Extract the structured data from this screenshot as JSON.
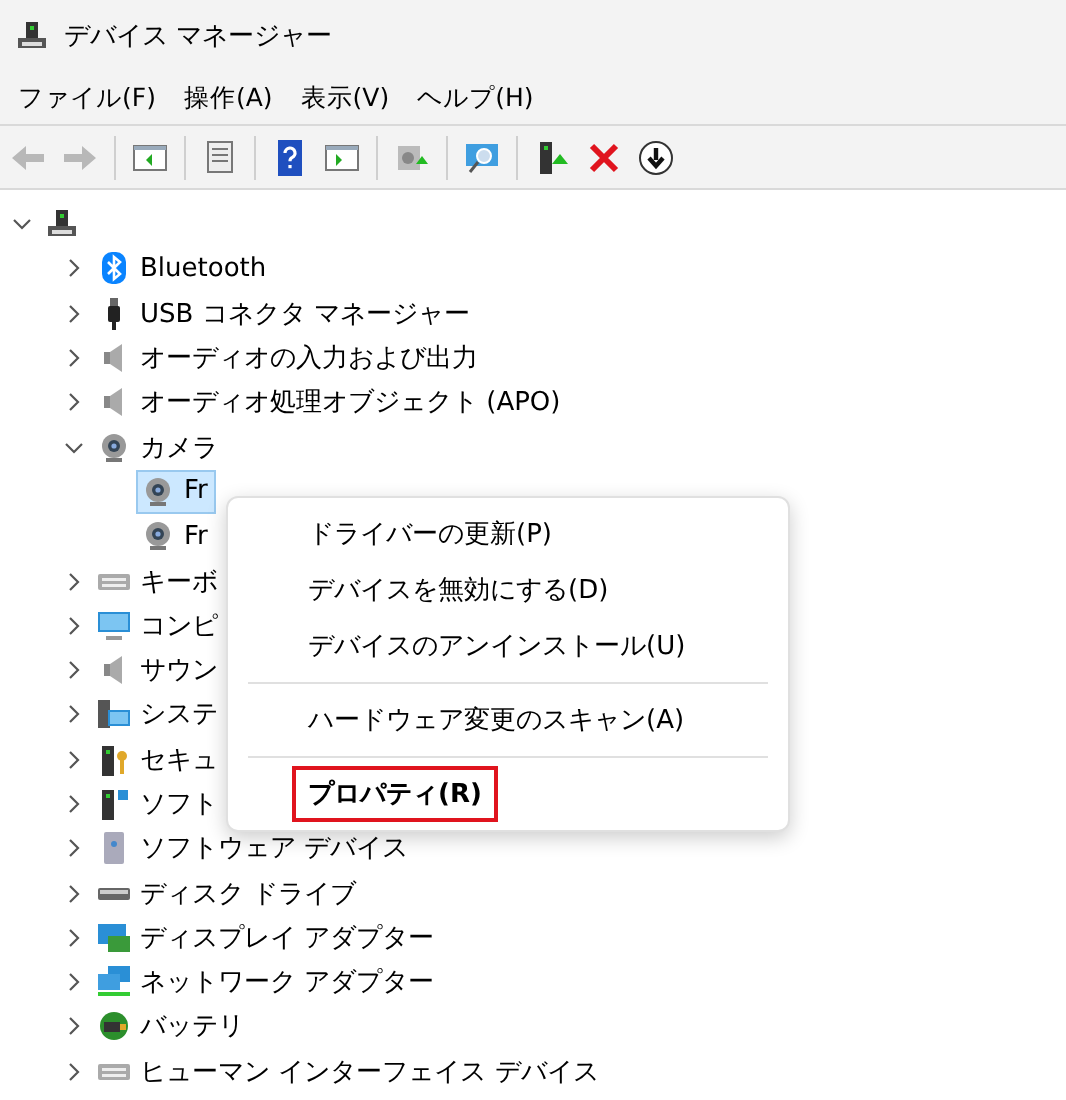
{
  "window": {
    "title": "デバイス マネージャー"
  },
  "menu": [
    "ファイル(F)",
    "操作(A)",
    "表示(V)",
    "ヘルプ(H)"
  ],
  "toolbar": [
    {
      "kind": "back",
      "disabled": true
    },
    {
      "kind": "forward",
      "disabled": true
    },
    {
      "kind": "separator"
    },
    {
      "kind": "tree"
    },
    {
      "kind": "separator"
    },
    {
      "kind": "properties"
    },
    {
      "kind": "separator"
    },
    {
      "kind": "help"
    },
    {
      "kind": "pane"
    },
    {
      "kind": "separator"
    },
    {
      "kind": "update"
    },
    {
      "kind": "separator"
    },
    {
      "kind": "scan"
    },
    {
      "kind": "separator"
    },
    {
      "kind": "enable"
    },
    {
      "kind": "uninstall"
    },
    {
      "kind": "disable"
    }
  ],
  "tree": {
    "kind": "computer",
    "expanded": true,
    "children": [
      {
        "label": "Bluetooth",
        "kind": "bluetooth",
        "expanded": false
      },
      {
        "label": "USB コネクタ マネージャー",
        "kind": "usb",
        "expanded": false
      },
      {
        "label": "オーディオの入力および出力",
        "kind": "speaker",
        "expanded": false
      },
      {
        "label": "オーディオ処理オブジェクト (APO)",
        "kind": "speaker",
        "expanded": false
      },
      {
        "label": "カメラ",
        "kind": "camera",
        "expanded": true,
        "children": [
          {
            "label": "Fr",
            "kind": "camera",
            "selected": true
          },
          {
            "label": "Fr",
            "kind": "camera",
            "selected": false
          }
        ]
      },
      {
        "label": "キーボ",
        "kind": "keyboard",
        "expanded": false
      },
      {
        "label": "コンピ",
        "kind": "monitor",
        "expanded": false
      },
      {
        "label": "サウン",
        "kind": "speaker",
        "expanded": false
      },
      {
        "label": "システ",
        "kind": "system",
        "expanded": false
      },
      {
        "label": "セキュ",
        "kind": "security",
        "expanded": false
      },
      {
        "label": "ソフト",
        "kind": "component",
        "expanded": false
      },
      {
        "label": "ソフトウェア デバイス",
        "kind": "softdevice",
        "expanded": false
      },
      {
        "label": "ディスク ドライブ",
        "kind": "disk",
        "expanded": false
      },
      {
        "label": "ディスプレイ アダプター",
        "kind": "display",
        "expanded": false
      },
      {
        "label": "ネットワーク アダプター",
        "kind": "network",
        "expanded": false
      },
      {
        "label": "バッテリ",
        "kind": "battery",
        "expanded": false
      },
      {
        "label": "ヒューマン インターフェイス デバイス",
        "kind": "keyboard",
        "expanded": false
      }
    ]
  },
  "context_menu": [
    {
      "kind": "item",
      "label": "ドライバーの更新(P)",
      "highlighted": false
    },
    {
      "kind": "item",
      "label": "デバイスを無効にする(D)",
      "highlighted": false
    },
    {
      "kind": "item",
      "label": "デバイスのアンインストール(U)",
      "highlighted": false
    },
    {
      "kind": "separator"
    },
    {
      "kind": "item",
      "label": "ハードウェア変更のスキャン(A)",
      "highlighted": false
    },
    {
      "kind": "separator"
    },
    {
      "kind": "item",
      "label": "プロパティ(R)",
      "highlighted": true
    }
  ]
}
